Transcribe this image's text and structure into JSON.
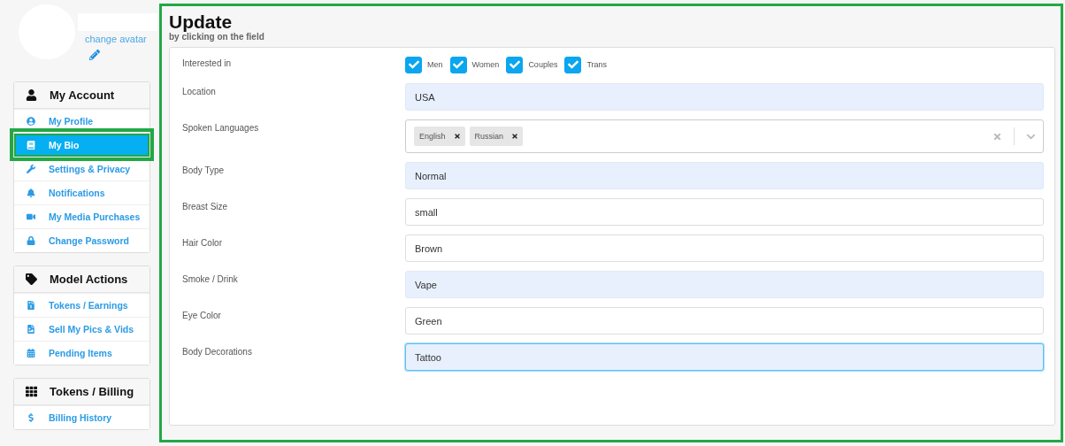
{
  "profile": {
    "change_avatar": "change avatar"
  },
  "nav_sections": [
    {
      "title": "My Account",
      "items": [
        {
          "label": "My Profile",
          "selected": false,
          "highlighted": false
        },
        {
          "label": "My Bio",
          "selected": true,
          "highlighted": true
        },
        {
          "label": "Settings & Privacy",
          "selected": false,
          "highlighted": false
        },
        {
          "label": "Notifications",
          "selected": false,
          "highlighted": false
        },
        {
          "label": "My Media Purchases",
          "selected": false,
          "highlighted": false
        },
        {
          "label": "Change Password",
          "selected": false,
          "highlighted": false
        }
      ]
    },
    {
      "title": "Model Actions",
      "items": [
        {
          "label": "Tokens / Earnings",
          "selected": false,
          "highlighted": false
        },
        {
          "label": "Sell My Pics & Vids",
          "selected": false,
          "highlighted": false
        },
        {
          "label": "Pending Items",
          "selected": false,
          "highlighted": false
        }
      ]
    },
    {
      "title": "Tokens / Billing",
      "items": [
        {
          "label": "Billing History",
          "selected": false,
          "highlighted": false
        }
      ]
    }
  ],
  "main": {
    "title": "Update",
    "subtitle": "by clicking on the field",
    "highlighted": true,
    "fields": [
      {
        "kind": "checkboxes",
        "label": "Interested in",
        "options": [
          {
            "label": "Men",
            "checked": true
          },
          {
            "label": "Women",
            "checked": true
          },
          {
            "label": "Couples",
            "checked": true
          },
          {
            "label": "Trans",
            "checked": true
          }
        ]
      },
      {
        "kind": "text",
        "label": "Location",
        "value": "USA",
        "autofilled": true,
        "focused": false
      },
      {
        "kind": "multiselect",
        "label": "Spoken Languages",
        "tags": [
          "English",
          "Russian"
        ]
      },
      {
        "kind": "text",
        "label": "Body Type",
        "value": "Normal",
        "autofilled": true,
        "focused": false
      },
      {
        "kind": "text",
        "label": "Breast Size",
        "value": "small",
        "autofilled": false,
        "focused": false
      },
      {
        "kind": "text",
        "label": "Hair Color",
        "value": "Brown",
        "autofilled": false,
        "focused": false
      },
      {
        "kind": "text",
        "label": "Smoke / Drink",
        "value": "Vape",
        "autofilled": true,
        "focused": false
      },
      {
        "kind": "text",
        "label": "Eye Color",
        "value": "Green",
        "autofilled": false,
        "focused": false
      },
      {
        "kind": "text",
        "label": "Body Decorations",
        "value": "Tattoo",
        "autofilled": true,
        "focused": true
      }
    ]
  }
}
